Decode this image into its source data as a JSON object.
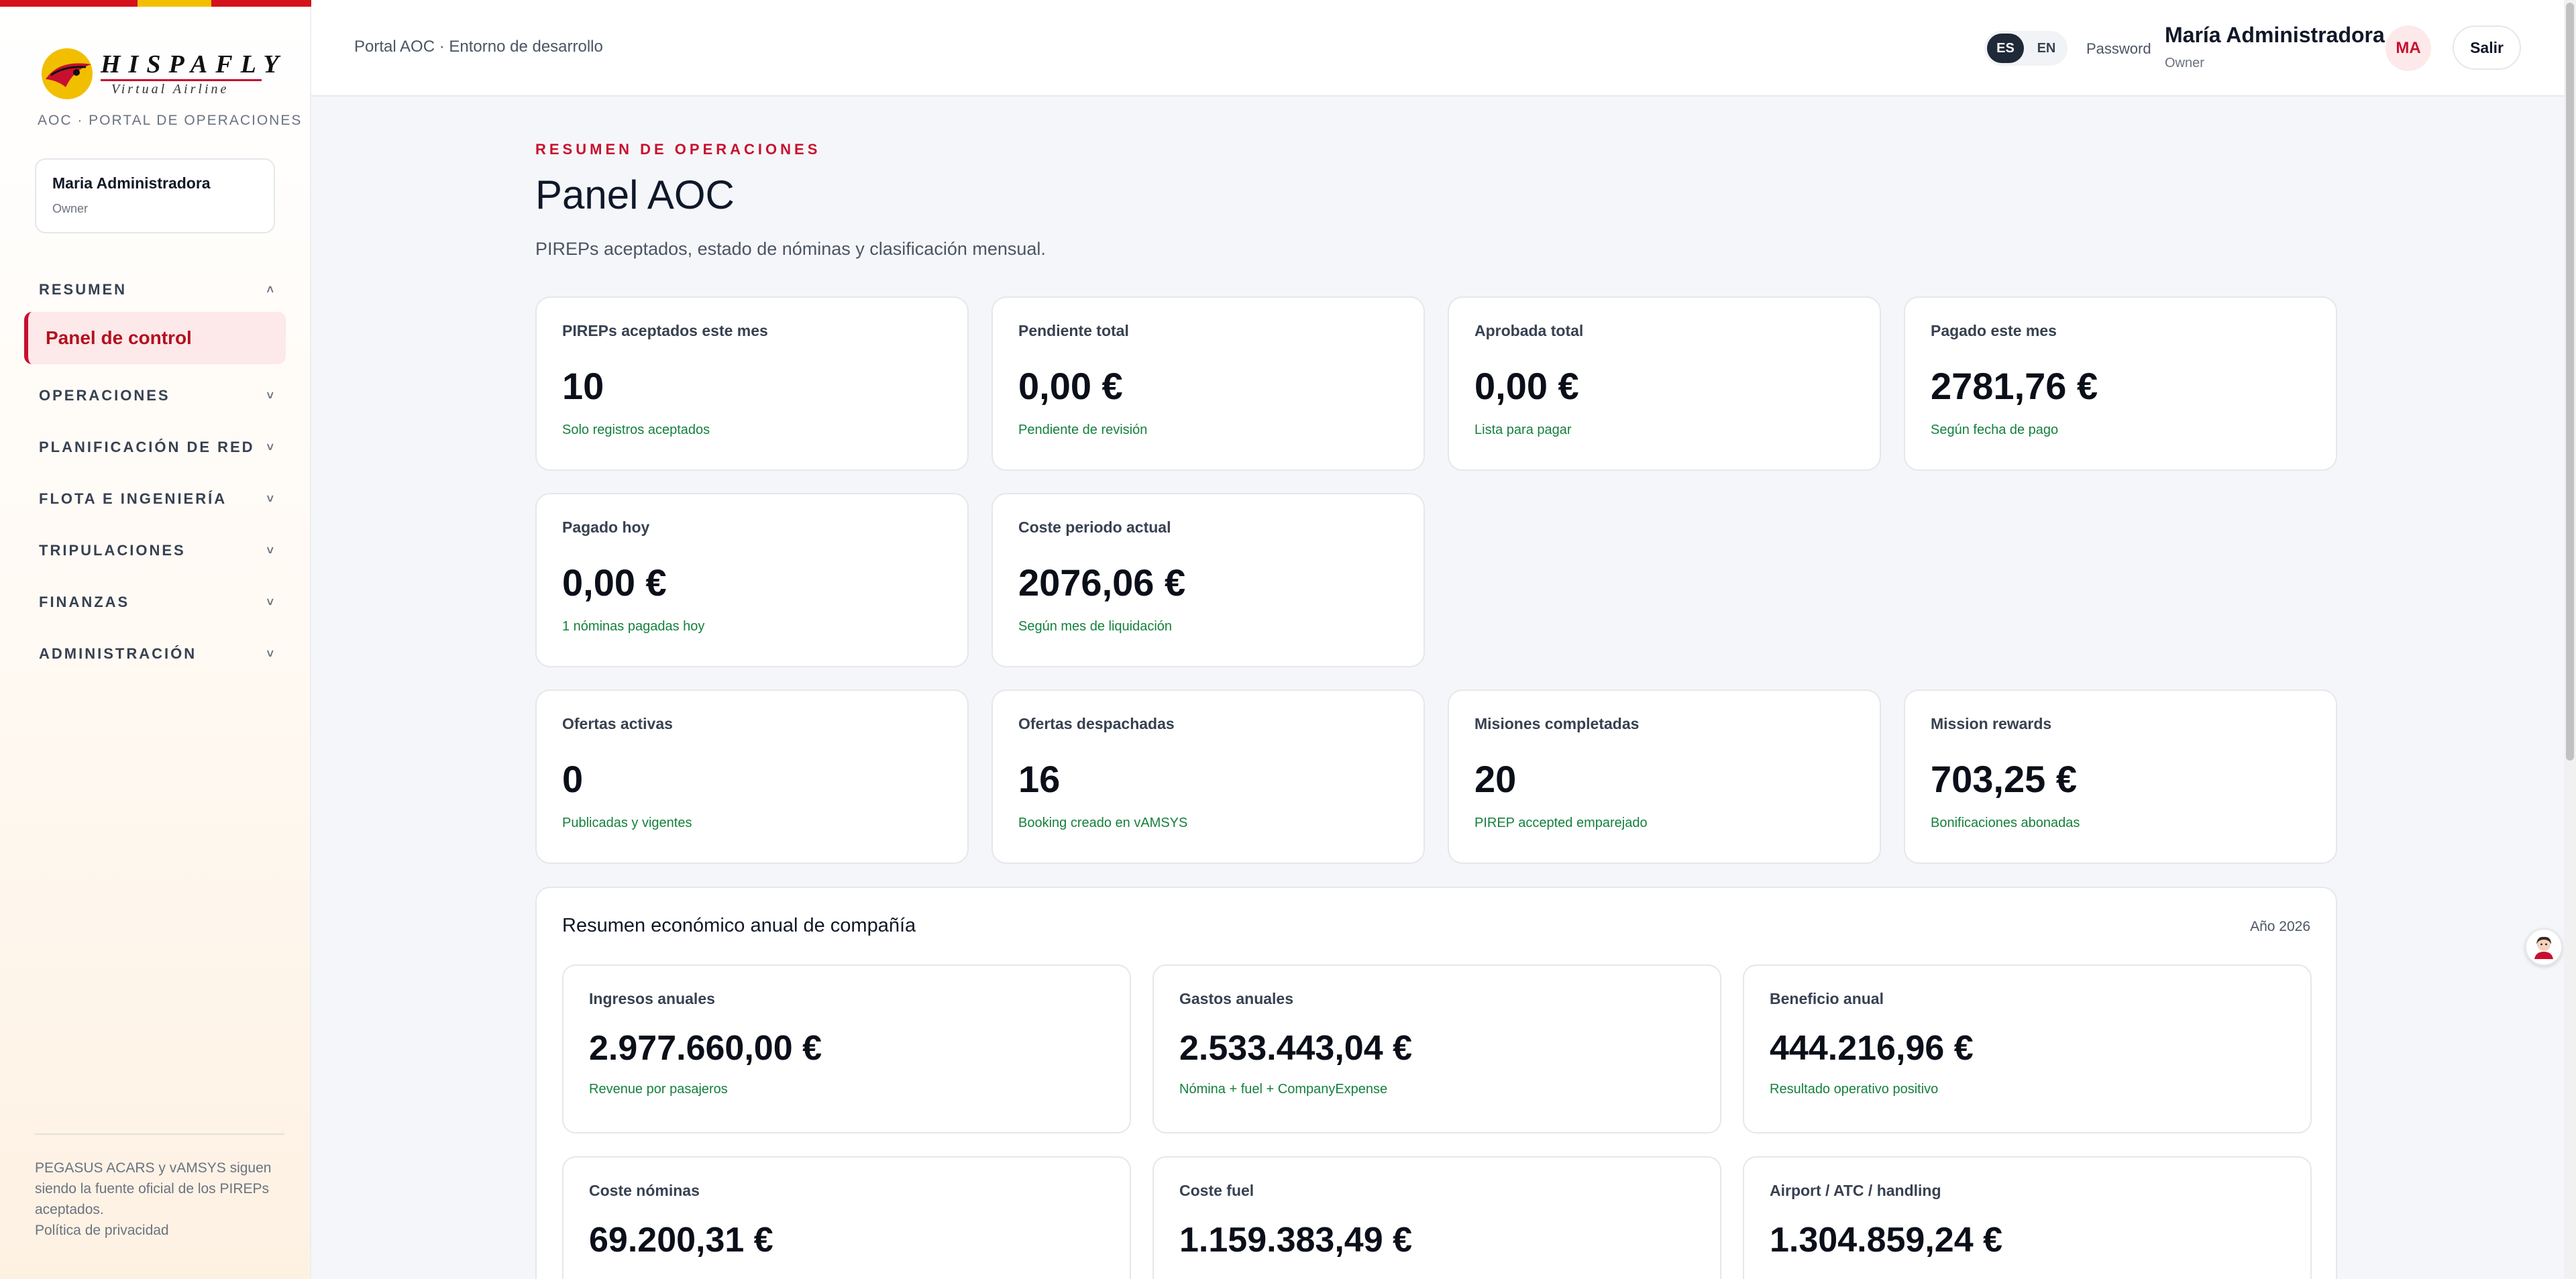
{
  "brand": {
    "logo_word": "HISPAFLY",
    "logo_sub": "Virtual Airline",
    "portal_label": "AOC · PORTAL DE OPERACIONES",
    "colors": {
      "accent": "#c8102e",
      "stripe_yellow": "#f1bf00",
      "positive": "#15803d"
    }
  },
  "sidebar": {
    "user": {
      "name": "Maria Administradora",
      "role": "Owner"
    },
    "sections": [
      {
        "label": "RESUMEN",
        "chevron": "˄",
        "items": [
          {
            "label": "Panel de control",
            "active": true
          }
        ]
      },
      {
        "label": "OPERACIONES",
        "chevron": "˅"
      },
      {
        "label": "PLANIFICACIÓN DE RED",
        "chevron": "˅"
      },
      {
        "label": "FLOTA E INGENIERÍA",
        "chevron": "˅"
      },
      {
        "label": "TRIPULACIONES",
        "chevron": "˅"
      },
      {
        "label": "FINANZAS",
        "chevron": "˅"
      },
      {
        "label": "ADMINISTRACIÓN",
        "chevron": "˅"
      }
    ],
    "footer": {
      "text": "PEGASUS ACARS y vAMSYS siguen siendo la fuente oficial de los PIREPs aceptados.",
      "privacy": "Política de privacidad"
    }
  },
  "topbar": {
    "breadcrumb": "Portal AOC · Entorno de desarrollo",
    "lang": {
      "es": "ES",
      "en": "EN",
      "active": "ES"
    },
    "password": "Password",
    "user_name": "María Administradora",
    "user_role": "Owner",
    "avatar": "MA",
    "logout": "Salir"
  },
  "header": {
    "eyebrow": "RESUMEN DE OPERACIONES",
    "title": "Panel AOC",
    "subtitle": "PIREPs aceptados, estado de nóminas y clasificación mensual."
  },
  "kpis": [
    {
      "label": "PIREPs aceptados este mes",
      "value": "10",
      "hint": "Solo registros aceptados"
    },
    {
      "label": "Pendiente total",
      "value": "0,00 €",
      "hint": "Pendiente de revisión"
    },
    {
      "label": "Aprobada total",
      "value": "0,00 €",
      "hint": "Lista para pagar"
    },
    {
      "label": "Pagado este mes",
      "value": "2781,76 €",
      "hint": "Según fecha de pago"
    },
    {
      "label": "Pagado hoy",
      "value": "0,00 €",
      "hint": "1 nóminas pagadas hoy"
    },
    {
      "label": "Coste periodo actual",
      "value": "2076,06 €",
      "hint": "Según mes de liquidación"
    },
    {
      "label": "Ofertas activas",
      "value": "0",
      "hint": "Publicadas y vigentes"
    },
    {
      "label": "Ofertas despachadas",
      "value": "16",
      "hint": "Booking creado en vAMSYS"
    },
    {
      "label": "Misiones completadas",
      "value": "20",
      "hint": "PIREP accepted emparejado"
    },
    {
      "label": "Mission rewards",
      "value": "703,25 €",
      "hint": "Bonificaciones abonadas"
    }
  ],
  "annual": {
    "title": "Resumen económico anual de compañía",
    "year": "Año 2026",
    "cards": [
      {
        "label": "Ingresos anuales",
        "value": "2.977.660,00 €",
        "hint": "Revenue por pasajeros"
      },
      {
        "label": "Gastos anuales",
        "value": "2.533.443,04 €",
        "hint": "Nómina + fuel + CompanyExpense"
      },
      {
        "label": "Beneficio anual",
        "value": "444.216,96 €",
        "hint": "Resultado operativo positivo"
      },
      {
        "label": "Coste nóminas",
        "value": "69.200,31 €",
        "hint": ""
      },
      {
        "label": "Coste fuel",
        "value": "1.159.383,49 €",
        "hint": ""
      },
      {
        "label": "Airport / ATC / handling",
        "value": "1.304.859,24 €",
        "hint": ""
      }
    ]
  },
  "icons": {
    "chat": "assistant-avatar-icon",
    "logo": "hispafly-logo-icon"
  }
}
